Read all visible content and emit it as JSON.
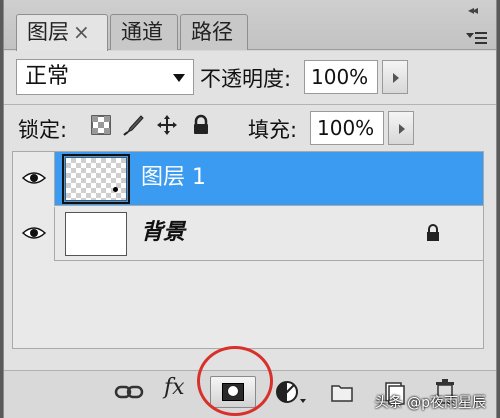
{
  "panel": {
    "tabs": [
      {
        "label": "图层",
        "close": "×",
        "active": true
      },
      {
        "label": "通道",
        "active": false
      },
      {
        "label": "路径",
        "active": false
      }
    ],
    "collapse_glyph": "◂◂",
    "blend_mode": "正常",
    "opacity_label": "不透明度:",
    "opacity_value": "100%",
    "lock_label": "锁定:",
    "fill_label": "填充:",
    "fill_value": "100%"
  },
  "layers": [
    {
      "name": "图层 1",
      "selected": true,
      "visible": true,
      "locked": false
    },
    {
      "name": "背景",
      "selected": false,
      "visible": true,
      "locked": true
    }
  ],
  "toolbar": {
    "fx_label": "fx",
    "buttons": [
      "link-layers-icon",
      "fx-icon",
      "add-mask-icon",
      "adjustment-layer-icon",
      "new-group-icon",
      "new-layer-icon",
      "delete-layer-icon"
    ]
  },
  "watermark": "头条 @p夜雨星辰",
  "colors": {
    "selection": "#3b9bf0",
    "highlight_ring": "#d8312b"
  }
}
